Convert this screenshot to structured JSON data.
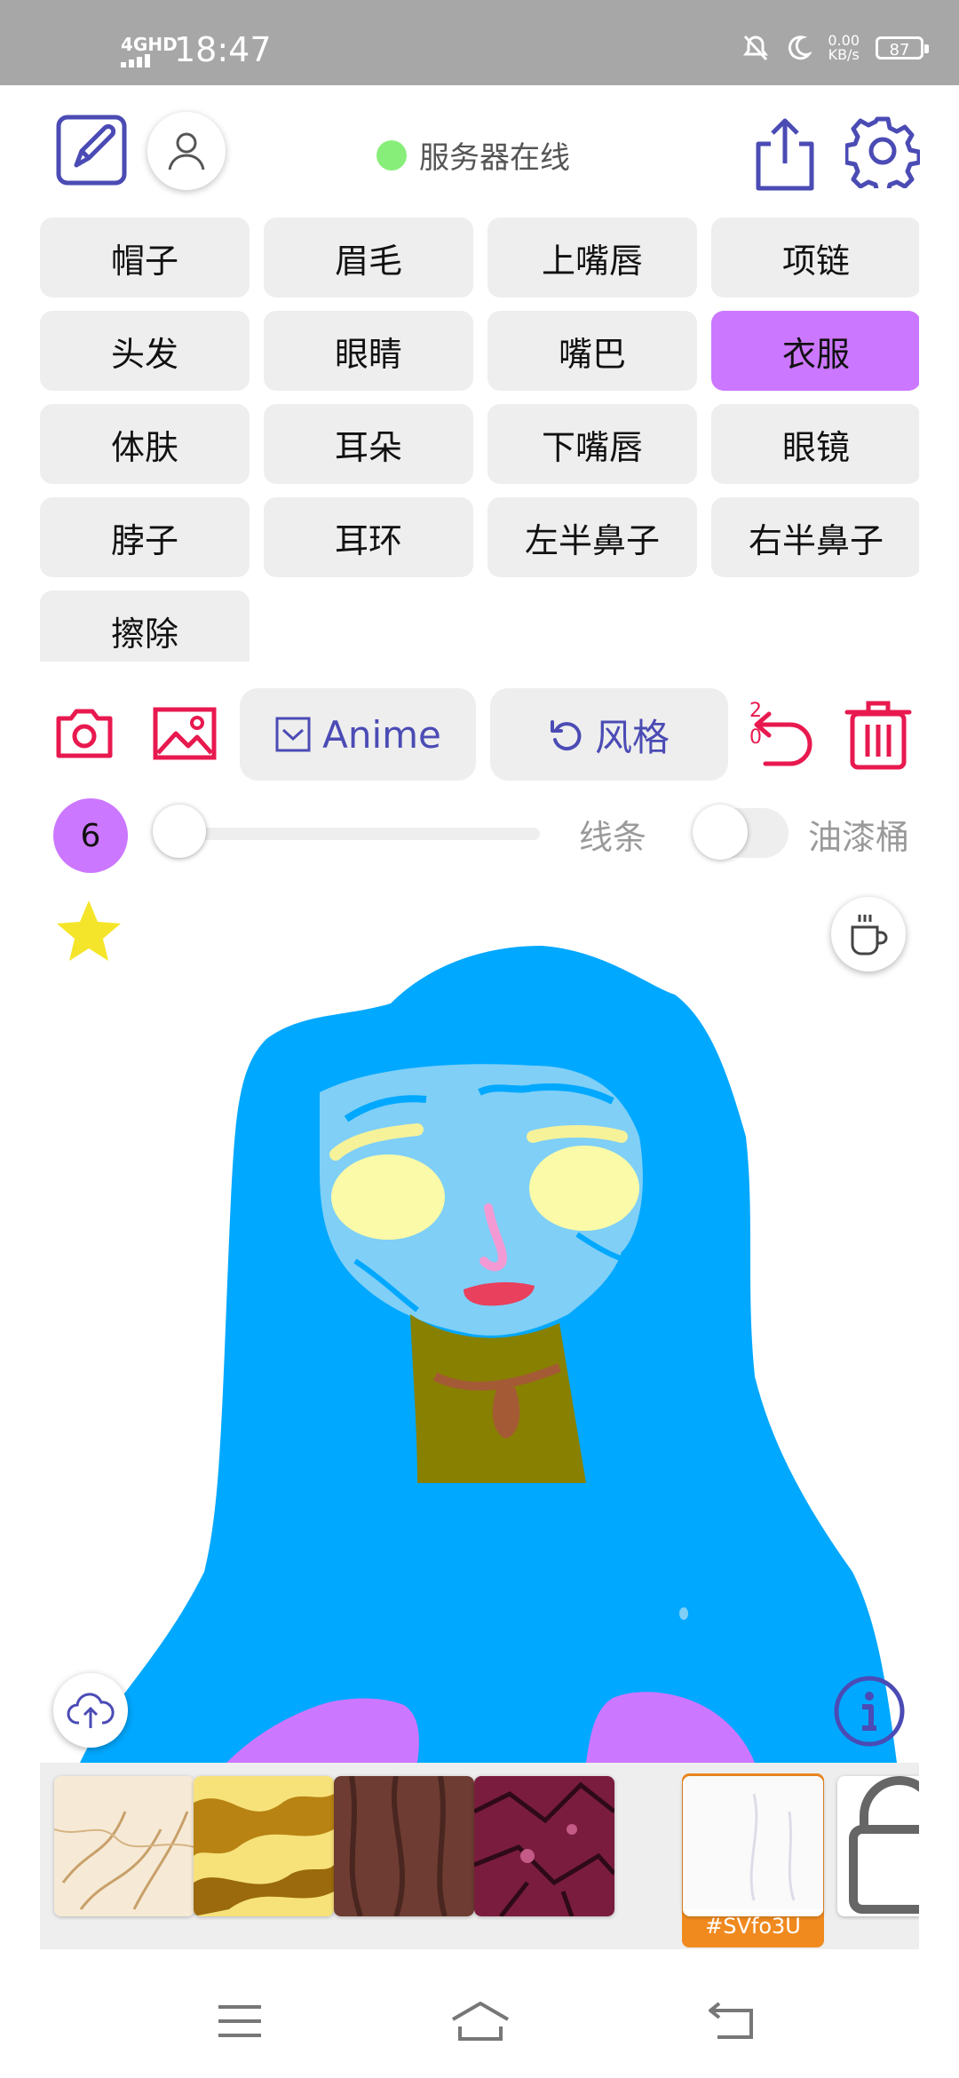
{
  "status_bar": {
    "network": "4GHD",
    "time": "18:47",
    "speed_value": "0.00",
    "speed_unit": "KB/s",
    "battery": "87"
  },
  "header": {
    "server_status": "服务器在线",
    "server_status_color": "#88ee7a"
  },
  "parts": [
    {
      "label": "帽子",
      "active": false
    },
    {
      "label": "眉毛",
      "active": false
    },
    {
      "label": "上嘴唇",
      "active": false
    },
    {
      "label": "项链",
      "active": false
    },
    {
      "label": "头发",
      "active": false
    },
    {
      "label": "眼睛",
      "active": false
    },
    {
      "label": "嘴巴",
      "active": false
    },
    {
      "label": "衣服",
      "active": true
    },
    {
      "label": "体肤",
      "active": false
    },
    {
      "label": "耳朵",
      "active": false
    },
    {
      "label": "下嘴唇",
      "active": false
    },
    {
      "label": "眼镜",
      "active": false
    },
    {
      "label": "脖子",
      "active": false
    },
    {
      "label": "耳环",
      "active": false
    },
    {
      "label": "左半鼻子",
      "active": false
    },
    {
      "label": "右半鼻子",
      "active": false
    },
    {
      "label": "擦除",
      "active": false
    }
  ],
  "toolbar": {
    "anime_label": "Anime",
    "style_label": "风格",
    "undo_count_top": "2",
    "undo_count_bottom": "0"
  },
  "brush": {
    "size": "6",
    "lines_label": "线条",
    "bucket_label": "油漆桶",
    "bucket_enabled": false
  },
  "textures": {
    "selected_index": 4,
    "selected_code": "#SVfo3U"
  },
  "colors": {
    "accent_purple": "#cc77ff",
    "icon_indigo": "#4b4bb5",
    "danger_red": "#e8194f",
    "hair_blue": "#00a8ff",
    "skin_blue": "#7fcff7",
    "selected_orange": "#f08a1f"
  }
}
